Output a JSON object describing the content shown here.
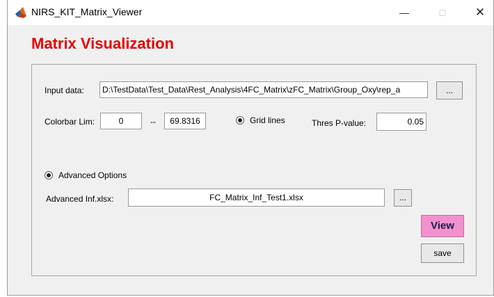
{
  "window": {
    "title": "NIRS_KIT_Matrix_Viewer",
    "minimize": "—",
    "maximize": "□",
    "close": "✕"
  },
  "heading": "Matrix Visualization",
  "input_data": {
    "label": "Input data:",
    "value": "D:\\TestData\\Test_Data\\Rest_Analysis\\4FC_Matrix\\zFC_Matrix\\Group_Oxy\\rep_a",
    "browse_label": "..."
  },
  "colorbar": {
    "label": "Colorbar Lim:",
    "min": "0",
    "separator": "--",
    "max": "69.8316"
  },
  "grid_lines": {
    "label": "Grid lines",
    "selected": true
  },
  "thres": {
    "label": "Thres P-value:",
    "value": "0.05"
  },
  "advanced": {
    "label": "Advanced Options",
    "selected": true,
    "file_label": "Advanced Inf.xlsx:",
    "file_value": "FC_Matrix_Inf_Test1.xlsx",
    "browse_label": "..."
  },
  "buttons": {
    "view": "View",
    "save": "save"
  },
  "colors": {
    "heading": "#e60000",
    "view_button": "#f291ce"
  }
}
